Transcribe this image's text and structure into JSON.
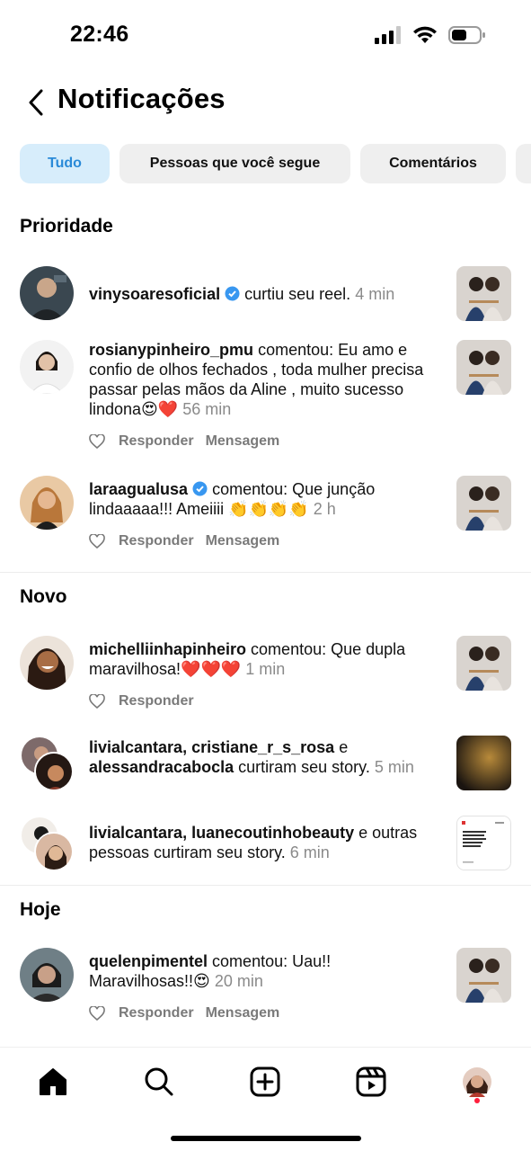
{
  "status": {
    "time": "22:46"
  },
  "header": {
    "title": "Notificações"
  },
  "chips": [
    {
      "label": "Tudo"
    },
    {
      "label": "Pessoas que você segue"
    },
    {
      "label": "Comentários"
    }
  ],
  "sections": {
    "priority": "Prioridade",
    "new": "Novo",
    "today": "Hoje"
  },
  "notifications": {
    "n1": {
      "user": "vinysoaresoficial",
      "text": "curtiu seu reel.",
      "time": "4 min"
    },
    "n2": {
      "user": "rosianypinheiro_pmu",
      "text": "comentou: Eu amo e confio de olhos fechados , toda mulher precisa passar pelas mãos da Aline , muito sucesso lindona😍❤️",
      "time": "56 min"
    },
    "n3": {
      "user": "laraagualusa",
      "text": "comentou: Que junção lindaaaaa!!! Ameiiii 👏👏👏👏",
      "time": "2 h"
    },
    "n4": {
      "user": "michelliinhapinheiro",
      "text": "comentou: Que dupla maravilhosa!❤️❤️❤️",
      "time": "1 min"
    },
    "n5": {
      "user1": "livialcantara",
      "user2": "cristiane_r_s_rosa",
      "conj": "e",
      "user3": "alessandracabocla",
      "text": "curtiram seu story.",
      "time": "5 min"
    },
    "n6": {
      "user1": "livialcantara",
      "user2": "luanecoutinhobeauty",
      "text": "e outras pessoas curtiram seu story.",
      "time": "6 min"
    },
    "n7": {
      "user": "quelenpimentel",
      "text": "comentou: Uau!! Maravilhosas!!😍",
      "time": "20 min"
    }
  },
  "actions": {
    "reply": "Responder",
    "message": "Mensagem"
  },
  "colors": {
    "accent": "#2a8ad8",
    "chip_active_bg": "#d7edfb",
    "verified": "#3897f0",
    "heart_red": "#ff1f3d"
  },
  "icons": [
    "back-chevron-icon",
    "verified-badge-icon",
    "heart-outline-icon",
    "home-icon",
    "search-icon",
    "create-plus-icon",
    "reels-icon",
    "profile-avatar"
  ]
}
